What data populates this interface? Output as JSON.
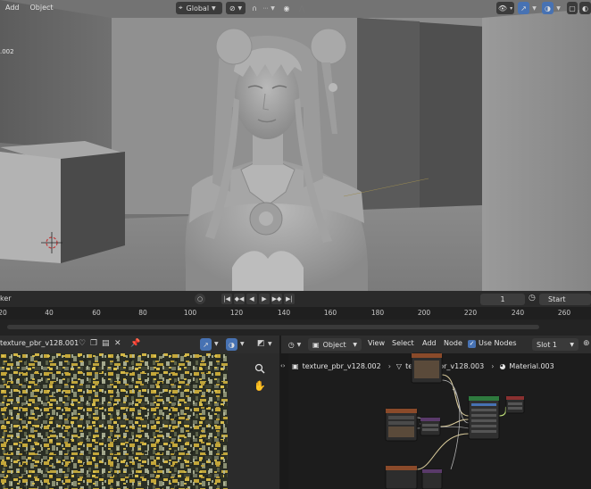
{
  "viewport": {
    "menu": [
      "Add",
      "Object"
    ],
    "object_label": ".002",
    "transform_orientation": "Global",
    "snap_icon": "magnet-icon",
    "proportional_icon": "proportional-edit-icon",
    "overlay_icons": [
      "visibility-icon",
      "gizmo-icon",
      "overlay-icon",
      "xray-icon",
      "solid-shading-icon"
    ]
  },
  "timeline": {
    "label": "ker",
    "current_frame": "1",
    "start_label": "Start",
    "ticks": [
      "20",
      "40",
      "60",
      "80",
      "100",
      "120",
      "140",
      "160",
      "180",
      "200",
      "220",
      "240",
      "260"
    ]
  },
  "image_editor": {
    "image_name": "texture_pbr_v128.001",
    "tools": [
      "zoom-icon",
      "hand-pan-icon"
    ]
  },
  "node_editor": {
    "object_mode": "Object",
    "menu": [
      "View",
      "Select",
      "Add",
      "Node"
    ],
    "use_nodes_label": "Use Nodes",
    "use_nodes": true,
    "slot": "Slot 1",
    "breadcrumb": [
      "texture_pbr_v128.002",
      "texture_pbr_v128.003",
      "Material.003"
    ]
  },
  "colors": {
    "accent": "#4772b3",
    "viewport_bg": "#6d6d6d",
    "panel_bg": "#2b2b2b",
    "header_bg": "#2e2e2e"
  }
}
